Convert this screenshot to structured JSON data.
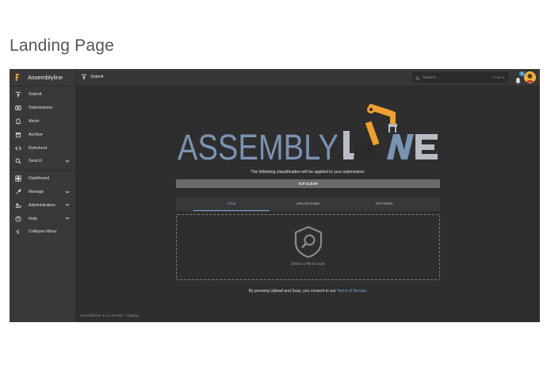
{
  "page_heading": "Landing Page",
  "app": {
    "name": "Assemblyline",
    "version_text": "Assemblyline 4.4.1.dev196 :: Staging"
  },
  "sidebar": {
    "items": [
      {
        "label": "Submit",
        "icon": "upload-icon"
      },
      {
        "label": "Submissions",
        "icon": "submissions-icon"
      },
      {
        "label": "Alerts",
        "icon": "bell-icon"
      },
      {
        "label": "Archive",
        "icon": "archive-icon"
      },
      {
        "label": "Retrohunt",
        "icon": "code-icon"
      },
      {
        "label": "Search",
        "icon": "search-icon",
        "expandable": true
      },
      {
        "label": "Dashboard",
        "icon": "dashboard-icon"
      },
      {
        "label": "Manage",
        "icon": "manage-icon",
        "expandable": true
      },
      {
        "label": "Administration",
        "icon": "admin-icon",
        "expandable": true
      },
      {
        "label": "Help",
        "icon": "help-icon",
        "expandable": true
      },
      {
        "label": "Collapse Menu",
        "icon": "chevron-left-icon"
      }
    ]
  },
  "topbar": {
    "title": "Submit",
    "search_placeholder": "Search ...",
    "search_shortcut": "CTRL+K",
    "notification_count": "0"
  },
  "submit": {
    "classification_notice": "The following classification will be applied to your submission:",
    "classification_value": "TLP:CLEAR",
    "tabs": [
      {
        "label": "FILE",
        "active": true
      },
      {
        "label": "URL/SHA256",
        "active": false
      },
      {
        "label": "OPTIONS",
        "active": false
      }
    ],
    "dropzone_label": "Select a file to scan",
    "consent_prefix": "By pressing Upload and Scan, you consent to our ",
    "consent_link": "Terms of Service",
    "consent_suffix": "."
  },
  "logo_text": {
    "part1": "ASSEMBLY",
    "part2": "LNE"
  },
  "colors": {
    "app_bg": "#2e2e2e",
    "sidebar_bg": "#393939",
    "logo_blue": "#7a93b3",
    "logo_orange": "#f0a030",
    "accent_blue": "#7fb0e6"
  }
}
